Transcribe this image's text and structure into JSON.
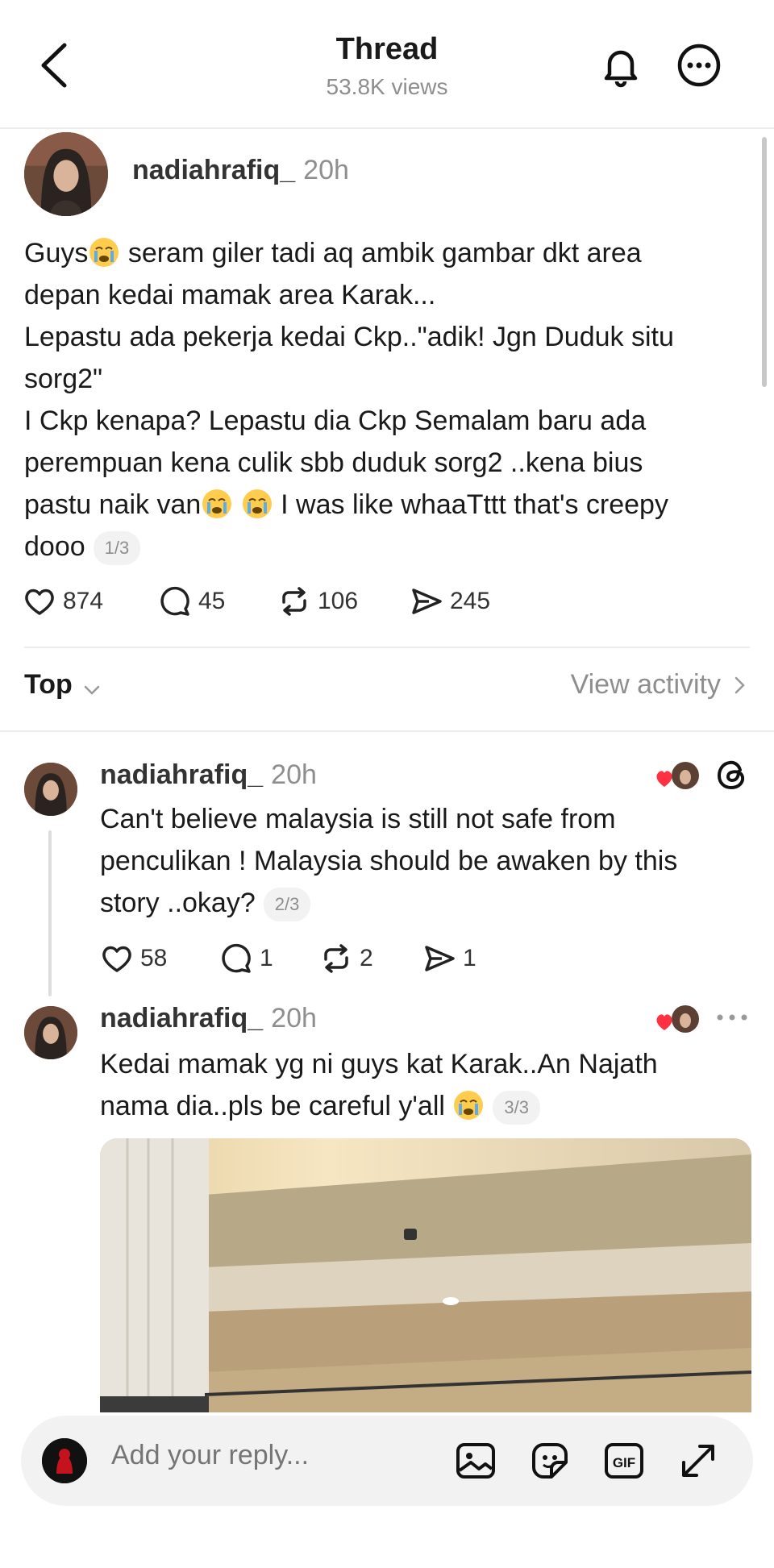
{
  "header": {
    "title": "Thread",
    "views": "53.8K views"
  },
  "post": {
    "username": "nadiahrafiq_",
    "time": "20h",
    "lines": [
      "seram giler tadi aq ambik gambar dkt area",
      "depan kedai mamak area Karak...",
      "Lepastu ada pekerja kedai Ckp..\"adik! Jgn Duduk situ",
      "sorg2\"",
      "I Ckp kenapa? Lepastu dia Ckp Semalam baru ada",
      "perempuan kena culik sbb duduk sorg2 ..kena bius"
    ],
    "line_start": "Guys",
    "line_van": "pastu naik van",
    "line_creepy": " I was like whaaTttt that's creepy",
    "line_last": "dooo",
    "pill": "1/3",
    "stats": {
      "likes": "874",
      "comments": "45",
      "reposts": "106",
      "shares": "245"
    }
  },
  "sort": {
    "label": "Top",
    "view_activity": "View activity"
  },
  "replies": [
    {
      "username": "nadiahrafiq_",
      "time": "20h",
      "text": "Can't believe malaysia is still not safe from\npenculikan ! Malaysia should be awaken by this\nstory ..okay?",
      "pill": "2/3",
      "stats": {
        "likes": "58",
        "comments": "1",
        "reposts": "2",
        "shares": "1"
      }
    },
    {
      "username": "nadiahrafiq_",
      "time": "20h",
      "line1": "Kedai mamak yg ni guys kat Karak..An Najath",
      "line2": "nama dia..pls be careful y'all",
      "pill": "3/3"
    }
  ],
  "reply_bar": {
    "placeholder": "Add your reply..."
  },
  "icons": {
    "back": "chevron-left-icon",
    "bell": "bell-icon",
    "more": "more-icon",
    "heart": "heart-icon",
    "comment": "comment-icon",
    "repost": "repost-icon",
    "share": "share-icon",
    "image": "image-icon",
    "sticker": "sticker-icon",
    "gif": "gif-icon",
    "expand": "expand-icon"
  },
  "colors": {
    "heart": "#ff3040",
    "muted": "#8e8e8e"
  }
}
